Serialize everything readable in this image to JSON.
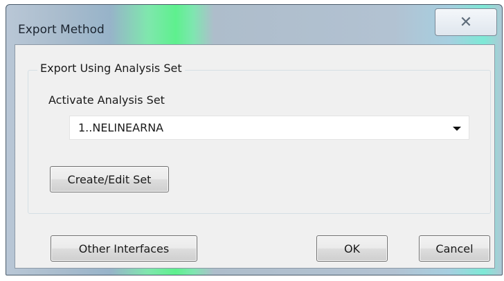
{
  "window": {
    "title": "Export Method",
    "close_glyph": "✕"
  },
  "export_group": {
    "legend": "Export Using Analysis Set",
    "activate_label": "Activate Analysis Set",
    "analysis_set_value": "1..NELINEARNA",
    "create_edit_label": "Create/Edit Set"
  },
  "buttons": {
    "other_interfaces": "Other Interfaces",
    "ok": "OK",
    "cancel": "Cancel"
  }
}
